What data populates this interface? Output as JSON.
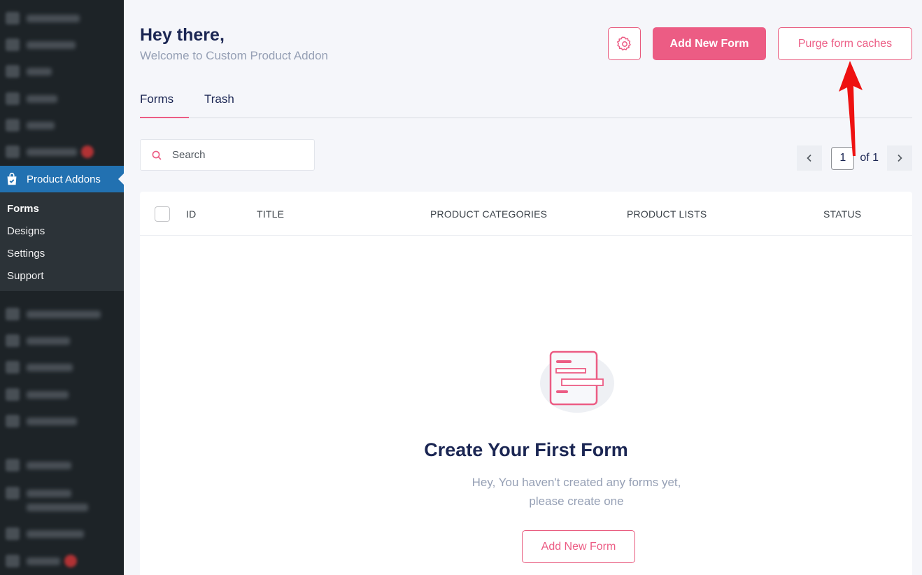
{
  "sidebar": {
    "blurred_items": [
      {
        "icon": "dashboard-icon"
      },
      {
        "icon": "elementor-icon"
      },
      {
        "icon": "posts-icon"
      },
      {
        "icon": "media-icon"
      },
      {
        "icon": "pages-icon"
      },
      {
        "icon": "comments-icon",
        "badge": true
      },
      {
        "icon": "woocommerce-icon"
      },
      {
        "icon": "products-icon"
      },
      {
        "icon": "payments-icon"
      },
      {
        "icon": "analytics-icon"
      },
      {
        "icon": "marketing-icon"
      },
      {
        "icon": "plugin-icon"
      },
      {
        "icon": "plugin-icon"
      },
      {
        "icon": "appearance-icon"
      },
      {
        "icon": "plugins-icon",
        "badge": true
      }
    ],
    "active_item": {
      "label": "Product Addons",
      "icon": "shopping-bag-icon"
    },
    "submenu": [
      "Forms",
      "Designs",
      "Settings",
      "Support"
    ],
    "active_color": "#2271b1"
  },
  "header": {
    "greeting": "Hey there,",
    "welcome": "Welcome to Custom Product Addon",
    "settings_icon": "gear-icon",
    "add_button": "Add New Form",
    "purge_button": "Purge form caches",
    "accent_color": "#ec5c84"
  },
  "tabs": [
    {
      "label": "Forms",
      "active": true
    },
    {
      "label": "Trash",
      "active": false
    }
  ],
  "search": {
    "placeholder": "Search"
  },
  "pagination": {
    "current": "1",
    "of_label": "of 1"
  },
  "table": {
    "columns": [
      "ID",
      "TITLE",
      "PRODUCT CATEGORIES",
      "PRODUCT LISTS",
      "STATUS"
    ]
  },
  "empty_state": {
    "title": "Create Your First Form",
    "line1": "Hey, You haven't created any forms yet,",
    "line2": "please create one",
    "button": "Add New Form"
  }
}
